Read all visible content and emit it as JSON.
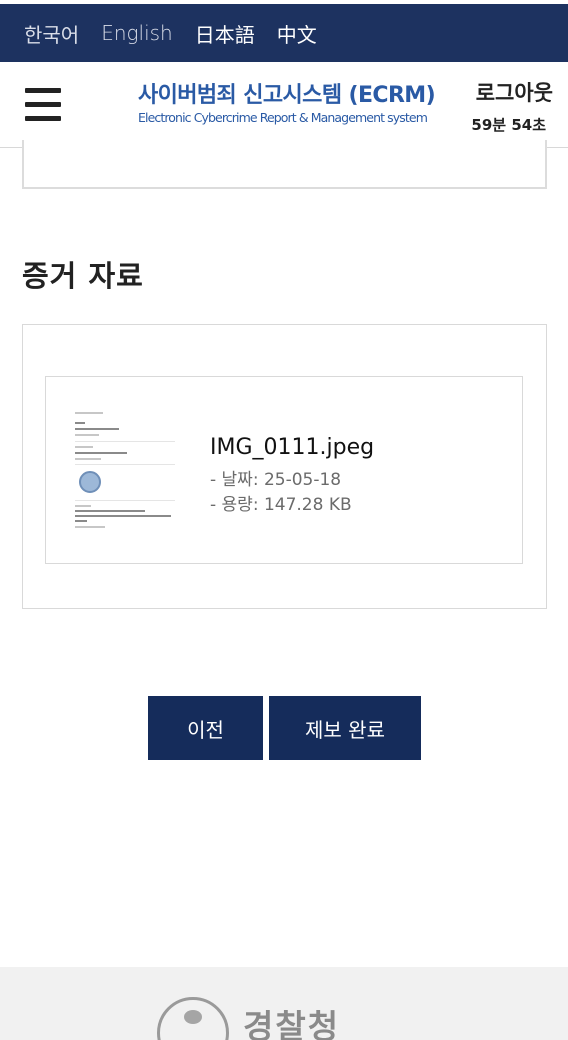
{
  "language_bar": {
    "korean": "한국어",
    "english": "English",
    "japanese": "日本語",
    "chinese": "中文"
  },
  "header": {
    "title": "사이버범죄 신고시스템 (ECRM)",
    "subtitle": "Electronic Cybercrime Report & Management system",
    "logout_label": "로그아웃",
    "timer": "59분 54초",
    "menu_icon": "hamburger-menu-icon"
  },
  "evidence": {
    "section_title": "증거 자료",
    "file": {
      "name": "IMG_0111.jpeg",
      "date": "- 날짜: 25-05-18",
      "size": "- 용량: 147.28 KB"
    }
  },
  "actions": {
    "prev_label": "이전",
    "submit_label": "제보 완료"
  },
  "footer": {
    "agency_name": "경찰청",
    "emblem_icon": "police-emblem-icon"
  },
  "colors": {
    "navy": "#1d3260",
    "button_navy": "#152c5b",
    "brand_blue": "#2a5aa5",
    "footer_gray": "#f1f1f1"
  }
}
